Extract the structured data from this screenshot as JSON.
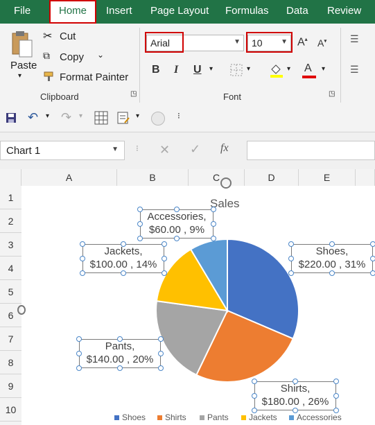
{
  "tabs": [
    "File",
    "Home",
    "Insert",
    "Page Layout",
    "Formulas",
    "Data",
    "Review"
  ],
  "active_tab": "Home",
  "clipboard": {
    "paste": "Paste",
    "cut": "Cut",
    "copy": "Copy",
    "format_painter": "Format Painter",
    "group_label": "Clipboard"
  },
  "font": {
    "family": "Arial",
    "size": "10",
    "group_label": "Font",
    "bold": "B",
    "italic": "I",
    "underline": "U",
    "grow": "A",
    "shrink": "A",
    "color": "A"
  },
  "name_box": "Chart 1",
  "formula_buttons": {
    "cancel": "✕",
    "enter": "✓",
    "fx": "fx"
  },
  "columns": [
    "A",
    "B",
    "C",
    "D",
    "E"
  ],
  "rows": [
    "1",
    "2",
    "3",
    "4",
    "5",
    "6",
    "7",
    "8",
    "9",
    "10"
  ],
  "colors": {
    "brand": "#217346",
    "highlight": "#d00000"
  },
  "chart_data": {
    "type": "pie",
    "title": "Sales",
    "slices": [
      {
        "name": "Shoes",
        "value": 220,
        "percent": 31,
        "label_line1": "Shoes,",
        "label_line2": "$220.00 , 31%",
        "color": "#4472C4"
      },
      {
        "name": "Shirts",
        "value": 180,
        "percent": 26,
        "label_line1": "Shirts,",
        "label_line2": "$180.00 , 26%",
        "color": "#ED7D31"
      },
      {
        "name": "Pants",
        "value": 140,
        "percent": 20,
        "label_line1": "Pants,",
        "label_line2": "$140.00 , 20%",
        "color": "#A5A5A5"
      },
      {
        "name": "Jackets",
        "value": 100,
        "percent": 14,
        "label_line1": "Jackets,",
        "label_line2": "$100.00 , 14%",
        "color": "#FFC000"
      },
      {
        "name": "Accessories",
        "value": 60,
        "percent": 9,
        "label_line1": "Accessories,",
        "label_line2": "$60.00 , 9%",
        "color": "#5B9BD5"
      }
    ],
    "legend": [
      "Shoes",
      "Shirts",
      "Pants",
      "Jackets",
      "Accessories"
    ],
    "legend_position": "bottom"
  }
}
